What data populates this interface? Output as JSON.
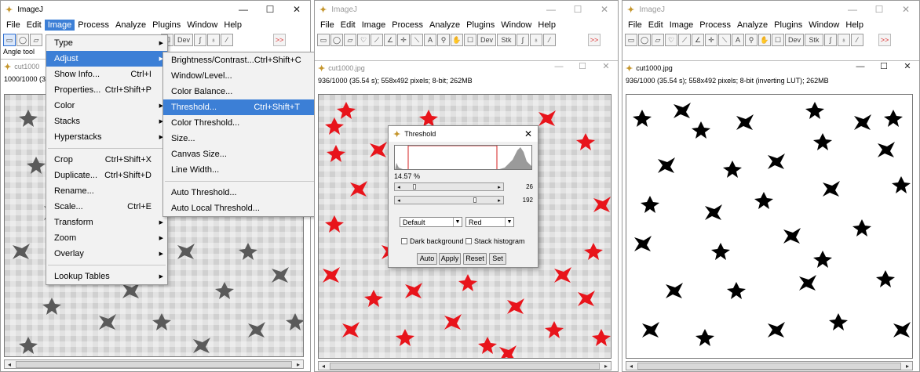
{
  "windows": [
    {
      "app_title": "ImageJ",
      "menus": [
        "File",
        "Edit",
        "Image",
        "Process",
        "Analyze",
        "Plugins",
        "Window",
        "Help"
      ],
      "active_menu": "Image",
      "status": "Angle tool",
      "image_title": "cut1000",
      "image_info": "1000/1000 (3"
    },
    {
      "app_title": "ImageJ",
      "menus": [
        "File",
        "Edit",
        "Image",
        "Process",
        "Analyze",
        "Plugins",
        "Window",
        "Help"
      ],
      "image_title": "cut1000.jpg",
      "image_info": "936/1000 (35.54 s); 558x492 pixels; 8-bit; 262MB"
    },
    {
      "app_title": "ImageJ",
      "menus": [
        "File",
        "Edit",
        "Image",
        "Process",
        "Analyze",
        "Plugins",
        "Window",
        "Help"
      ],
      "image_title": "cut1000.jpg",
      "image_info": "936/1000 (35.54 s); 558x492 pixels; 8-bit (inverting LUT); 262MB"
    }
  ],
  "toolbar": {
    "dev_label": "Dev",
    "stk_label": "Stk",
    "more_label": ">>"
  },
  "window_caps": {
    "min": "—",
    "max": "☐",
    "close": "✕"
  },
  "image_menu": [
    {
      "label": "Type",
      "shortcut": "",
      "submenu": true
    },
    {
      "label": "Adjust",
      "shortcut": "",
      "submenu": true,
      "highlight": true
    },
    {
      "label": "Show Info...",
      "shortcut": "Ctrl+I"
    },
    {
      "label": "Properties...",
      "shortcut": "Ctrl+Shift+P"
    },
    {
      "label": "Color",
      "shortcut": "",
      "submenu": true
    },
    {
      "label": "Stacks",
      "shortcut": "",
      "submenu": true
    },
    {
      "label": "Hyperstacks",
      "shortcut": "",
      "submenu": true
    },
    {
      "sep": true
    },
    {
      "label": "Crop",
      "shortcut": "Ctrl+Shift+X"
    },
    {
      "label": "Duplicate...",
      "shortcut": "Ctrl+Shift+D"
    },
    {
      "label": "Rename...",
      "shortcut": ""
    },
    {
      "label": "Scale...",
      "shortcut": "Ctrl+E"
    },
    {
      "label": "Transform",
      "shortcut": "",
      "submenu": true
    },
    {
      "label": "Zoom",
      "shortcut": "",
      "submenu": true
    },
    {
      "label": "Overlay",
      "shortcut": "",
      "submenu": true
    },
    {
      "sep": true
    },
    {
      "label": "Lookup Tables",
      "shortcut": "",
      "submenu": true
    }
  ],
  "adjust_menu": [
    {
      "label": "Brightness/Contrast...",
      "shortcut": "Ctrl+Shift+C"
    },
    {
      "label": "Window/Level...",
      "shortcut": ""
    },
    {
      "label": "Color Balance...",
      "shortcut": ""
    },
    {
      "label": "Threshold...",
      "shortcut": "Ctrl+Shift+T",
      "highlight": true
    },
    {
      "label": "Color Threshold...",
      "shortcut": ""
    },
    {
      "label": "Size...",
      "shortcut": ""
    },
    {
      "label": "Canvas Size...",
      "shortcut": ""
    },
    {
      "label": "Line Width...",
      "shortcut": ""
    },
    {
      "sep": true
    },
    {
      "label": "Auto Threshold...",
      "shortcut": ""
    },
    {
      "label": "Auto Local Threshold...",
      "shortcut": ""
    }
  ],
  "threshold_dialog": {
    "title": "Threshold",
    "percent": "14.57 %",
    "min_value": "26",
    "max_value": "192",
    "min_fraction": 0.1,
    "max_fraction": 0.75,
    "method": "Default",
    "mode": "Red",
    "dark_background": "Dark background",
    "stack_histogram": "Stack histogram",
    "buttons": [
      "Auto",
      "Apply",
      "Reset",
      "Set"
    ]
  },
  "colors": {
    "highlight": "#3c7fd6",
    "threshold_red": "#e8141b",
    "cell_dark": "#4a4a4a"
  }
}
